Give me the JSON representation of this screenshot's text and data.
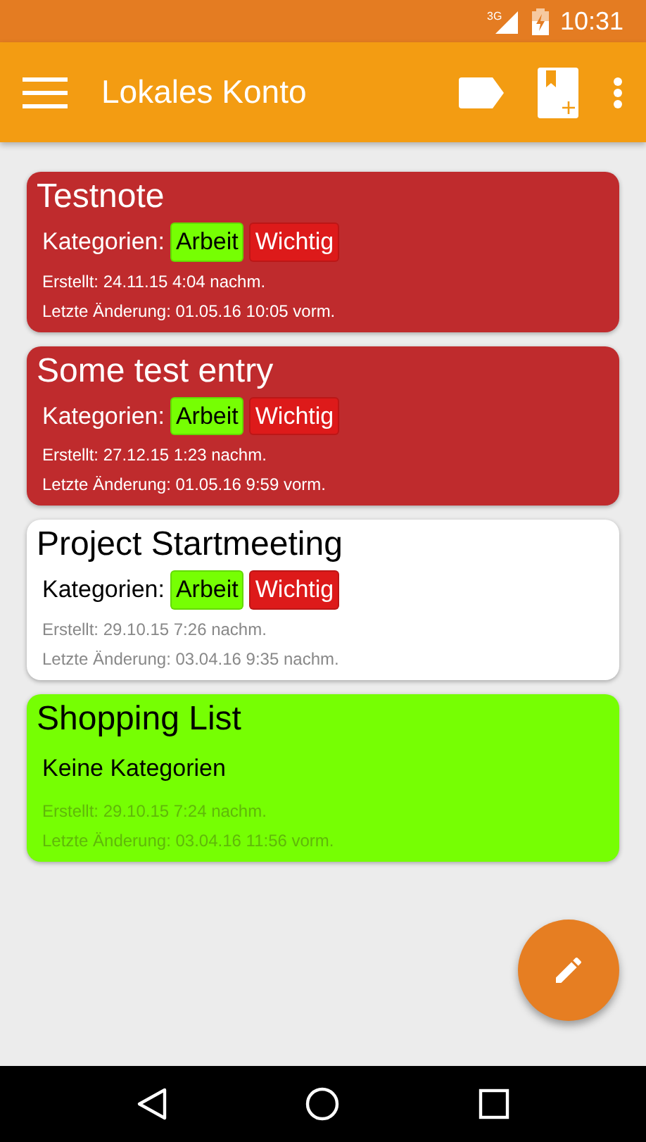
{
  "status_bar": {
    "network": "3G",
    "time": "10:31"
  },
  "toolbar": {
    "title": "Lokales Konto"
  },
  "notes": [
    {
      "title": "Testnote",
      "color": "#bf2b2d",
      "categories_label": "Kategorien:",
      "categories": [
        {
          "name": "Arbeit",
          "color": "#76ff03"
        },
        {
          "name": "Wichtig",
          "color": "#dd1a1a"
        }
      ],
      "created": "Erstellt: 24.11.15 4:04 nachm.",
      "modified": "Letzte Änderung: 01.05.16 10:05 vorm."
    },
    {
      "title": "Some test entry",
      "color": "#bf2b2d",
      "categories_label": "Kategorien:",
      "categories": [
        {
          "name": "Arbeit",
          "color": "#76ff03"
        },
        {
          "name": "Wichtig",
          "color": "#dd1a1a"
        }
      ],
      "created": "Erstellt: 27.12.15 1:23 nachm.",
      "modified": "Letzte Änderung: 01.05.16 9:59 vorm."
    },
    {
      "title": "Project Startmeeting",
      "color": "#ffffff",
      "categories_label": "Kategorien:",
      "categories": [
        {
          "name": "Arbeit",
          "color": "#76ff03"
        },
        {
          "name": "Wichtig",
          "color": "#dd1a1a"
        }
      ],
      "created": "Erstellt: 29.10.15 7:26 nachm.",
      "modified": "Letzte Änderung: 03.04.16 9:35 nachm."
    },
    {
      "title": "Shopping List",
      "color": "#76ff03",
      "categories_label": "Keine Kategorien",
      "created": "Erstellt: 29.10.15 7:24 nachm.",
      "modified": "Letzte Änderung: 03.04.16 11:56 vorm."
    }
  ]
}
